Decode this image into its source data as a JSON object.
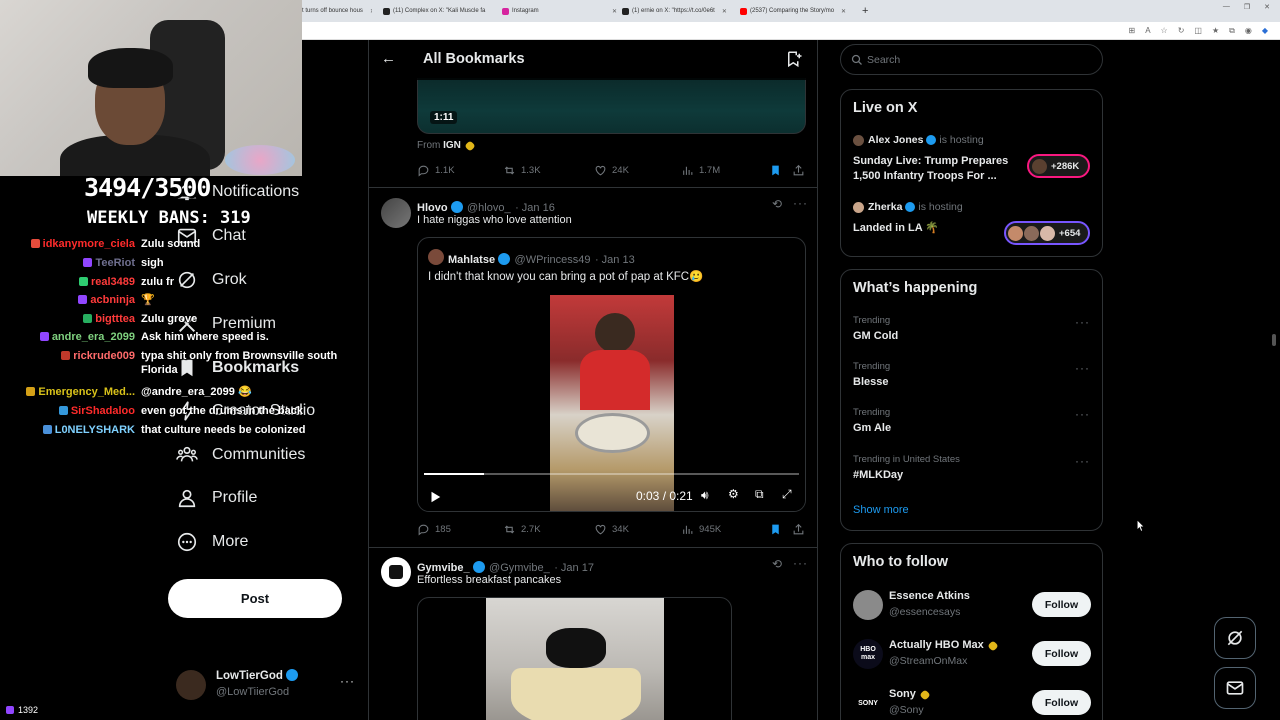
{
  "browser": {
    "tabs": [
      {
        "label": "t turns off bounce hous"
      },
      {
        "label": "(11) Complex on X: \"Kali Muscle fa"
      },
      {
        "label": "Instagram"
      },
      {
        "label": "(1) ernie on X: \"https://t.co/0e6t"
      },
      {
        "label": "(2537) Comparing the Story/mo"
      }
    ]
  },
  "stream": {
    "counter": "3494/3500",
    "weekly_bans": "WEEKLY BANS: 319",
    "viewers": "1392",
    "chat": [
      {
        "user": "idkanymore_ciela",
        "msg": "Zulu sound",
        "color": "#ff2b2b"
      },
      {
        "user": "TeeRiot",
        "msg": "sigh",
        "color": "#6f6f8f"
      },
      {
        "user": "real3489",
        "msg": "zulu fr",
        "color": "#ff3b3b"
      },
      {
        "user": "acbninja",
        "msg": "🏆",
        "color": "#ff3b3b"
      },
      {
        "user": "bigtttea",
        "msg": "Zulu grove",
        "color": "#ff3b3b"
      },
      {
        "user": "andre_era_2099",
        "msg": "Ask him where speed is.",
        "color": "#7fd17f"
      },
      {
        "user": "rickrude009",
        "msg": "typa shit only from Brownsville south Florida",
        "color": "#ff6b6b"
      },
      {
        "user": "Emergency_Med...",
        "msg": "@andre_era_2099 😂",
        "color": "#d9c21a"
      },
      {
        "user": "SirShadaloo",
        "msg": "even got the drums in the back",
        "color": "#ff2b2b"
      },
      {
        "user": "L0NELYSHARK",
        "msg": "that culture needs be colonized",
        "color": "#7fd1ff"
      }
    ]
  },
  "nav": {
    "items": [
      {
        "label": "Notifications",
        "icon": "bell-icon"
      },
      {
        "label": "Chat",
        "icon": "mail-icon"
      },
      {
        "label": "Grok",
        "icon": "grok-icon"
      },
      {
        "label": "Premium",
        "icon": "x-logo-icon"
      },
      {
        "label": "Bookmarks",
        "icon": "bookmark-icon"
      },
      {
        "label": "Creator Studio",
        "icon": "lightning-icon"
      },
      {
        "label": "Communities",
        "icon": "people-icon"
      },
      {
        "label": "Profile",
        "icon": "person-icon"
      },
      {
        "label": "More",
        "icon": "more-circle-icon"
      }
    ],
    "post_label": "Post",
    "account": {
      "name": "LowTierGod",
      "handle": "@LowTiierGod"
    }
  },
  "main": {
    "title": "All Bookmarks",
    "tweet0": {
      "video_time": "1:11",
      "from_label": "From",
      "from_source": "IGN",
      "stats": {
        "replies": "1.1K",
        "reposts": "1.3K",
        "likes": "24K",
        "views": "1.7M"
      }
    },
    "tweet1": {
      "name": "Hlovo",
      "handle": "@hlovo_",
      "date": "· Jan 16",
      "text": "I hate niggas who love attention",
      "quote": {
        "name": "Mahlatse",
        "handle": "@WPrincess49",
        "date": "· Jan 13",
        "text": "I didn't that know you can bring a pot of pap at KFC🥲",
        "video_time": "0:03 / 0:21",
        "progress": 0.16
      },
      "stats": {
        "replies": "185",
        "reposts": "2.7K",
        "likes": "34K",
        "views": "945K"
      }
    },
    "tweet2": {
      "name": "Gymvibe_",
      "handle": "@Gymvibe_",
      "date": "· Jan 17",
      "text": "Effortless breakfast pancakes"
    }
  },
  "sidebar": {
    "search_placeholder": "Search",
    "live": {
      "title": "Live on X",
      "hosting_label": "is hosting",
      "spaces": [
        {
          "host": "Alex Jones",
          "title": "Sunday Live: Trump Prepares 1,500 Infantry Troops For ...",
          "count": "+286K",
          "accent": "#f91880"
        },
        {
          "host": "Zherka",
          "title": "Landed in LA 🌴",
          "count": "+654",
          "accent": "#7856ff"
        }
      ]
    },
    "happening": {
      "title": "What’s happening",
      "trends": [
        {
          "label": "Trending",
          "value": "GM Cold"
        },
        {
          "label": "Trending",
          "value": "Blesse"
        },
        {
          "label": "Trending",
          "value": "Gm Ale"
        },
        {
          "label": "Trending in United States",
          "value": "#MLKDay"
        }
      ],
      "show_more": "Show more"
    },
    "follow": {
      "title": "Who to follow",
      "follow_label": "Follow",
      "accounts": [
        {
          "name": "Essence Atkins",
          "handle": "@essencesays",
          "avatar_text": ""
        },
        {
          "name": "Actually HBO Max",
          "handle": "@StreamOnMax",
          "avatar_text": "HBO max"
        },
        {
          "name": "Sony",
          "handle": "@Sony",
          "avatar_text": "SONY"
        }
      ]
    }
  },
  "colors": {
    "accent": "#1d9bf0",
    "bg": "#000000",
    "border": "#2f3336",
    "muted": "#71767b"
  }
}
